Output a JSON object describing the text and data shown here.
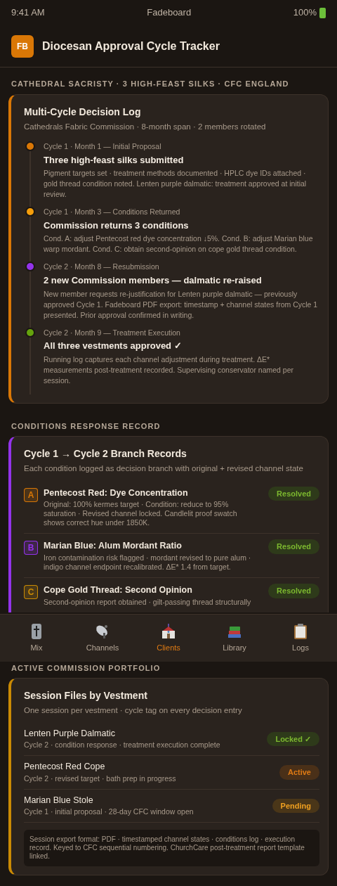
{
  "status_bar": {
    "time": "9:41 AM",
    "carrier": "Fadeboard",
    "battery": "100%"
  },
  "header": {
    "logo": "FB",
    "title": "Diocesan Approval Cycle Tracker"
  },
  "decision_section": {
    "label": "CATHEDRAL SACRISTY · 3 HIGH-FEAST SILKS · CFC ENGLAND",
    "color": "#d97706",
    "title": "Multi-Cycle Decision Log",
    "subtitle": "Cathedrals Fabric Commission · 8-month span · 2 members rotated",
    "events": [
      {
        "meta": "Cycle 1 · Month 1 — Initial Proposal",
        "title": "Three high-feast silks submitted",
        "body": "Pigment targets set · treatment methods documented · HPLC dye IDs attached · gold thread condition noted. Lenten purple dalmatic: treatment approved at initial review.",
        "color": "#d97706"
      },
      {
        "meta": "Cycle 1 · Month 3 — Conditions Returned",
        "title": "Commission returns 3 conditions",
        "body": "Cond. A: adjust Pentecost red dye concentration ↓5%. Cond. B: adjust Marian blue warp mordant. Cond. C: obtain second-opinion on cope gold thread condition.",
        "color": "#f59e0b"
      },
      {
        "meta": "Cycle 2 · Month 8 — Resubmission",
        "title": "2 new Commission members — dalmatic re-raised",
        "body": "New member requests re-justification for Lenten purple dalmatic — previously approved Cycle 1. Fadeboard PDF export: timestamp + channel states from Cycle 1 presented. Prior approval confirmed in writing.",
        "color": "#9333ea"
      },
      {
        "meta": "Cycle 2 · Month 9 — Treatment Execution",
        "title": "All three vestments approved ✓",
        "body": "Running log captures each channel adjustment during treatment. ΔE* measurements post-treatment recorded. Supervising conservator named per session.",
        "color": "#65a30d"
      }
    ]
  },
  "conditions_section": {
    "label": "CONDITIONS RESPONSE RECORD",
    "color": "#9333ea",
    "title": "Cycle 1 → Cycle 2 Branch Records",
    "subtitle": "Each condition logged as decision branch with original + revised channel state",
    "items": [
      {
        "letter": "A",
        "color": "#d97706",
        "title": "Pentecost Red: Dye Concentration",
        "body": "Original: 100% kermes target · Condition: reduce to 95% saturation · Revised channel locked. Candlelit proof swatch shows correct hue under 1850K.",
        "status": {
          "label": "Resolved",
          "kind": "resolved"
        }
      },
      {
        "letter": "B",
        "color": "#9333ea",
        "title": "Marian Blue: Alum Mordant Ratio",
        "body": "Iron contamination risk flagged · mordant revised to pure alum · indigo channel endpoint recalibrated. ΔE* 1.4 from target.",
        "status": {
          "label": "Resolved",
          "kind": "resolved"
        }
      },
      {
        "letter": "C",
        "color": "#ca8a04",
        "title": "Cope Gold Thread: Second Opinion",
        "body": "Second-opinion report obtained · gilt-passing thread structurally",
        "status": {
          "label": "Resolved",
          "kind": "resolved"
        }
      }
    ]
  },
  "tab_bar": [
    {
      "label": "Mix",
      "selected": false
    },
    {
      "label": "Channels",
      "selected": false
    },
    {
      "label": "Clients",
      "selected": true
    },
    {
      "label": "Library",
      "selected": false
    },
    {
      "label": "Logs",
      "selected": false
    }
  ],
  "portfolio_section": {
    "label": "ACTIVE COMMISSION PORTFOLIO",
    "color": "#ca8a04",
    "title": "Session Files by Vestment",
    "subtitle": "One session per vestment · cycle tag on every decision entry",
    "sessions": [
      {
        "name": "Lenten Purple Dalmatic",
        "detail": "Cycle 2 · condition response · treatment execution complete",
        "status": {
          "label": "Locked ✓",
          "kind": "locked"
        }
      },
      {
        "name": "Pentecost Red Cope",
        "detail": "Cycle 2 · revised target · bath prep in progress",
        "status": {
          "label": "Active",
          "kind": "active"
        }
      },
      {
        "name": "Marian Blue Stole",
        "detail": "Cycle 1 · initial proposal · 28-day CFC window open",
        "status": {
          "label": "Pending",
          "kind": "pending"
        }
      }
    ],
    "note": "Session export format: PDF · timestamped channel states · conditions log · execution record. Keyed to CFC sequential numbering. ChurchCare post-treatment report template linked."
  }
}
